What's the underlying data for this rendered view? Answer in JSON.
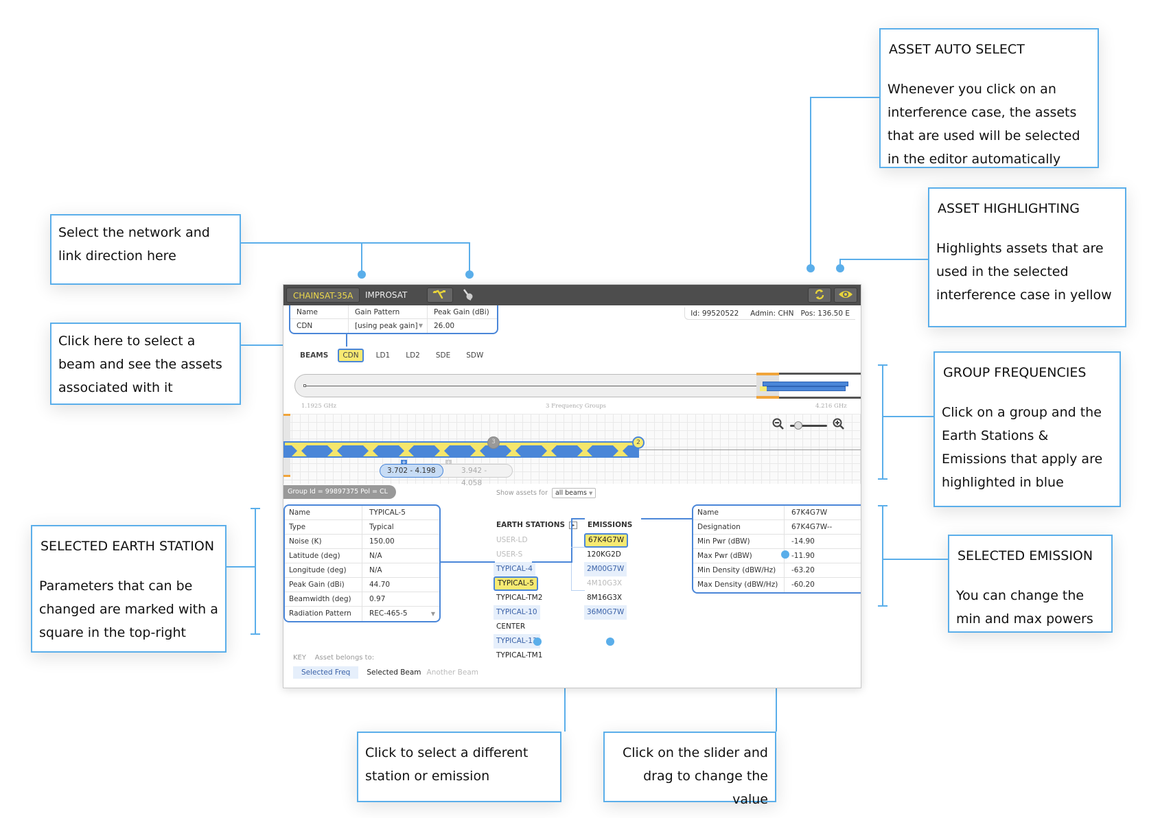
{
  "app": {
    "networks": [
      "CHAINSAT-35A",
      "IMPROSAT"
    ],
    "selected_network": "CHAINSAT-35A",
    "link_direction_icons": [
      "uplink-icon",
      "downlink-icon"
    ],
    "right_icons": [
      "sync-icon",
      "eye-icon"
    ],
    "beam_table": {
      "headers": [
        "Name",
        "Gain Pattern",
        "Peak Gain (dBi)"
      ],
      "row": [
        "CDN",
        "[using peak gain]",
        "26.00"
      ]
    },
    "info": {
      "id_label": "Id:",
      "id": "99520522",
      "admin_label": "Admin:",
      "admin": "CHN",
      "pos_label": "Pos:",
      "pos": "136.50 E"
    },
    "beams": {
      "label": "BEAMS",
      "items": [
        "CDN",
        "LD1",
        "LD2",
        "SDE",
        "SDW"
      ],
      "selected": "CDN"
    },
    "overview": {
      "start_freq": "1.1925 GHz",
      "groups_label": "3 Frequency Groups",
      "end_freq": "4.216 GHz"
    },
    "group_view": {
      "badges": [
        "3",
        "2"
      ],
      "ranges": [
        "3.702 - 4.198",
        "3.942 - 4.058"
      ],
      "group_info": "Group Id = 99897375  Pol = CL"
    },
    "show_assets": {
      "label": "Show assets for",
      "value": "all beams"
    },
    "earth_station": {
      "rows": [
        {
          "k": "Name",
          "v": "TYPICAL-5"
        },
        {
          "k": "Type",
          "v": "Typical"
        },
        {
          "k": "Noise (K)",
          "v": "150.00"
        },
        {
          "k": "Latitude (deg)",
          "v": "N/A"
        },
        {
          "k": "Longitude (deg)",
          "v": "N/A"
        },
        {
          "k": "Peak Gain (dBi)",
          "v": "44.70"
        },
        {
          "k": "Beamwidth (deg)",
          "v": "0.97"
        },
        {
          "k": "Radiation Pattern",
          "v": "REC-465-5"
        }
      ]
    },
    "earth_stations": {
      "header": "EARTH STATIONS",
      "items": [
        {
          "name": "USER-LD",
          "state": "other"
        },
        {
          "name": "USER-S",
          "state": "other"
        },
        {
          "name": "TYPICAL-4",
          "state": "freq"
        },
        {
          "name": "TYPICAL-5",
          "state": "sel"
        },
        {
          "name": "TYPICAL-TM2",
          "state": "beam"
        },
        {
          "name": "TYPICAL-10",
          "state": "freq"
        },
        {
          "name": "CENTER",
          "state": "beam"
        },
        {
          "name": "TYPICAL-13",
          "state": "freq"
        },
        {
          "name": "TYPICAL-TM1",
          "state": "beam"
        }
      ]
    },
    "emissions": {
      "header": "EMISSIONS",
      "items": [
        {
          "name": "67K4G7W",
          "state": "sel"
        },
        {
          "name": "120KG2D",
          "state": "beam"
        },
        {
          "name": "2M00G7W",
          "state": "freq"
        },
        {
          "name": "4M10G3X",
          "state": "other"
        },
        {
          "name": "8M16G3X",
          "state": "beam"
        },
        {
          "name": "36M0G7W",
          "state": "freq"
        }
      ]
    },
    "emission": {
      "rows": [
        {
          "k": "Name",
          "v": "67K4G7W"
        },
        {
          "k": "Designation",
          "v": "67K4G7W--"
        },
        {
          "k": "Min Pwr (dBW)",
          "v": "-14.90"
        },
        {
          "k": "Max Pwr (dBW)",
          "v": "-11.90"
        },
        {
          "k": "Min Density (dBW/Hz)",
          "v": "-63.20"
        },
        {
          "k": "Max Density (dBW/Hz)",
          "v": "-60.20"
        }
      ]
    },
    "key": {
      "label": "KEY",
      "desc": "Asset belongs to:",
      "items": [
        "Selected Freq",
        "Selected Beam",
        "Another Beam"
      ]
    }
  },
  "callouts": {
    "network": {
      "body": "Select the network and link direction here"
    },
    "beam": {
      "body": "Click here to select a beam and see the assets associated with it"
    },
    "auto_select": {
      "title": "ASSET AUTO SELECT",
      "body": "Whenever you click on an interference case, the assets that are used will be selected in the editor automatically"
    },
    "highlighting": {
      "title": "ASSET HIGHLIGHTING",
      "body": "Highlights assets that are used in the selected interference case in yellow"
    },
    "group_freq": {
      "title": "GROUP FREQUENCIES",
      "body": "Click on a group and the Earth Stations & Emissions that apply are highlighted in blue"
    },
    "earth_station": {
      "title": "SELECTED EARTH STATION",
      "body": "Parameters that can be changed are marked with a square in the top-right"
    },
    "emission": {
      "title": "SELECTED EMISSION",
      "body": "You can change the min and max powers"
    },
    "select_station": {
      "body": "Click to select a different station or emission"
    },
    "slider": {
      "body": "Click on the slider  and drag to change the value"
    }
  }
}
